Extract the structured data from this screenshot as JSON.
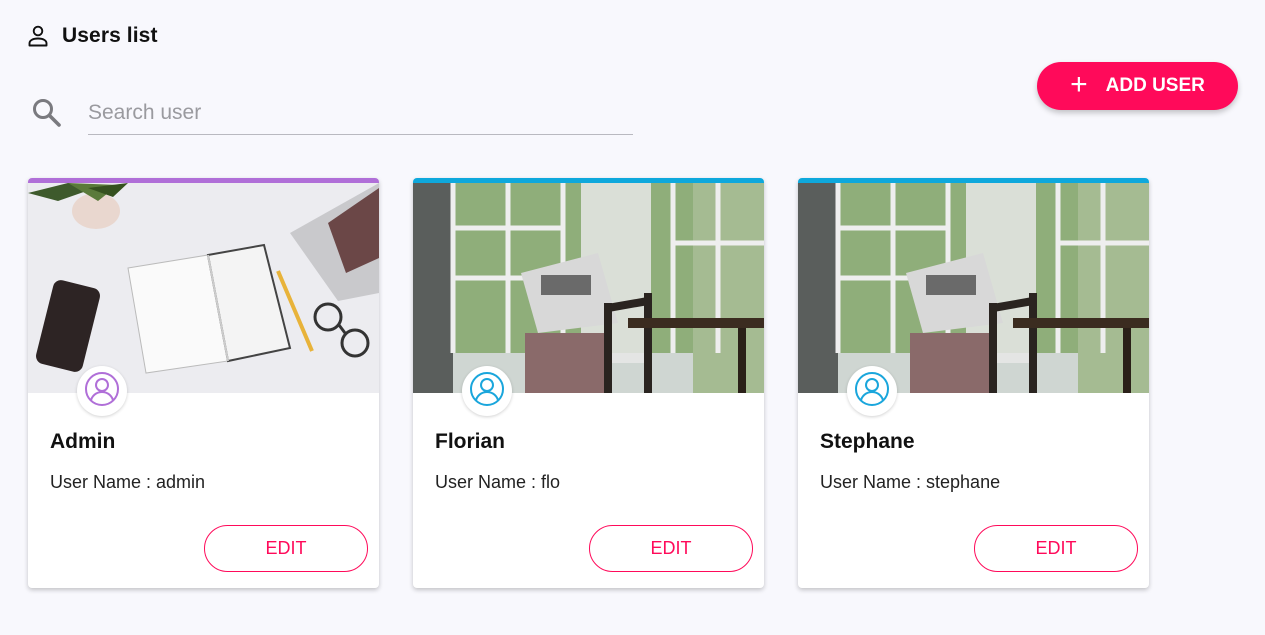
{
  "header": {
    "title": "Users list",
    "icon": "user-outline-icon"
  },
  "search": {
    "placeholder": "Search user",
    "value": "",
    "icon": "search-icon"
  },
  "toolbar": {
    "add_label": "ADD USER",
    "add_icon": "plus-icon",
    "accent_color": "#ff0a5a"
  },
  "users": [
    {
      "name": "Admin",
      "username_line": "User Name : admin",
      "edit_label": "EDIT",
      "stripe_color": "#b06fd8",
      "avatar_color": "#b06fd8",
      "image": "desk-workspace-photo"
    },
    {
      "name": "Florian",
      "username_line": "User Name : flo",
      "edit_label": "EDIT",
      "stripe_color": "#0ea8dc",
      "avatar_color": "#1aa6dc",
      "image": "man-reading-newspaper-photo"
    },
    {
      "name": "Stephane",
      "username_line": "User Name : stephane",
      "edit_label": "EDIT",
      "stripe_color": "#0ea8dc",
      "avatar_color": "#1aa6dc",
      "image": "man-reading-newspaper-photo"
    }
  ]
}
